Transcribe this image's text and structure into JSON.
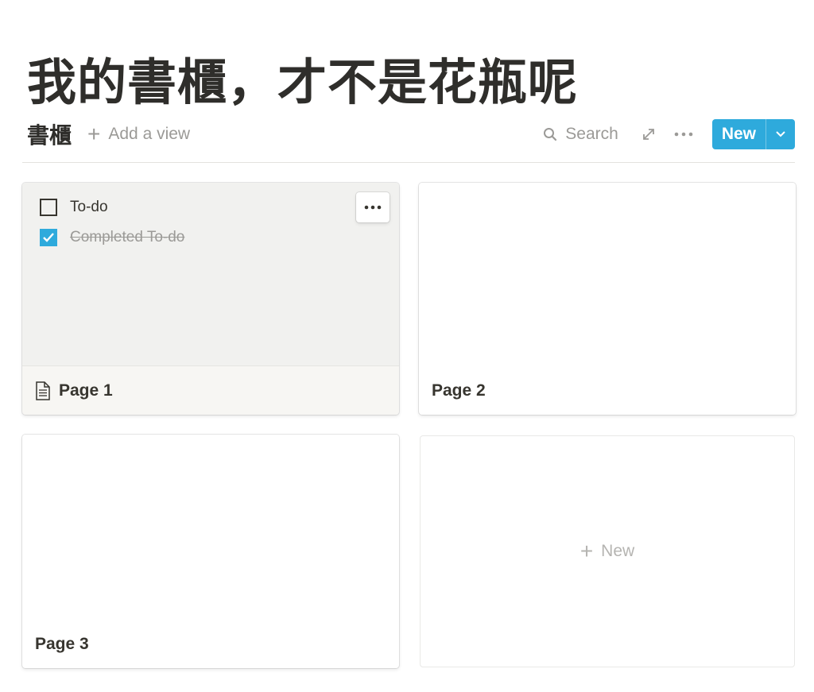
{
  "page": {
    "title": "我的書櫃，才不是花瓶呢"
  },
  "database": {
    "title": "書櫃",
    "add_view_label": "Add a view",
    "search_label": "Search",
    "new_button_label": "New",
    "icons": {
      "add": "plus-icon",
      "search": "search-icon",
      "expand": "expand-icon",
      "more": "more-icon",
      "dropdown": "chevron-down-icon"
    }
  },
  "cards": [
    {
      "title": "Page 1",
      "has_page_icon": true,
      "preview": {
        "todos": [
          {
            "text": "To-do",
            "checked": false
          },
          {
            "text": "Completed To-do",
            "checked": true
          }
        ]
      }
    },
    {
      "title": "Page 2"
    },
    {
      "title": "Page 3"
    }
  ],
  "new_card": {
    "label": "New"
  },
  "colors": {
    "accent": "#2eaadc",
    "text": "#37352f",
    "muted": "#9b9a97",
    "preview_bg": "#f1f1ef"
  }
}
